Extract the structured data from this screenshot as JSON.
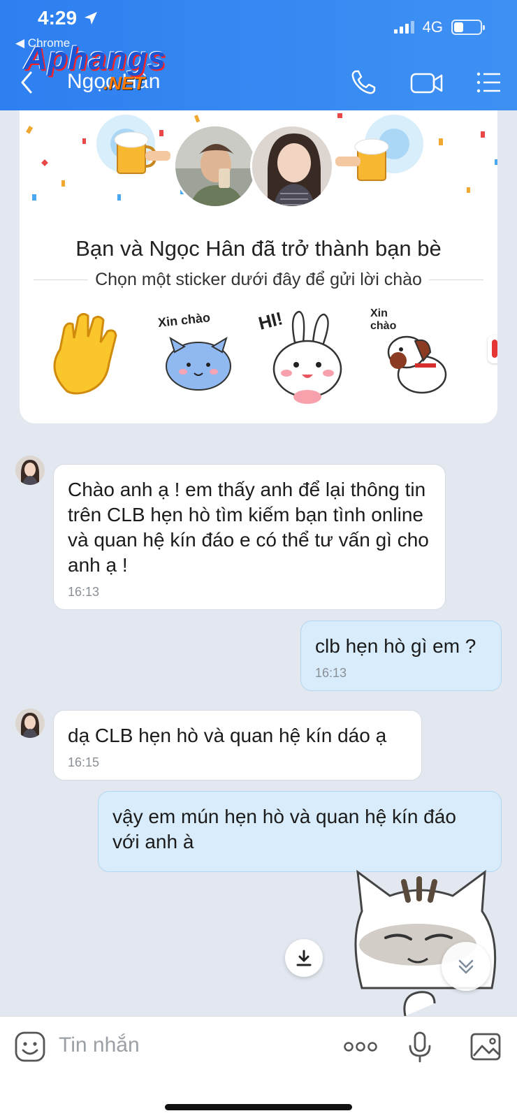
{
  "status_bar": {
    "time": "4:29",
    "back_app": "◀ Chrome",
    "network": "4G",
    "battery_level": 0.35
  },
  "header": {
    "chat_name": "Ngọc Hân",
    "watermark": "Aphangs",
    "watermark_suffix": ".NET"
  },
  "friend_card": {
    "title": "Bạn và Ngọc Hân đã trở thành bạn bè",
    "subtitle": "Chọn một sticker dưới đây để gửi lời chào",
    "stickers": [
      {
        "name": "wave-hand-sticker"
      },
      {
        "name": "blue-cat-sticker",
        "caption": "Xin chào"
      },
      {
        "name": "bunny-hi-sticker",
        "caption": "HI!"
      },
      {
        "name": "dog-sticker",
        "caption": "Xin chào"
      }
    ]
  },
  "messages": [
    {
      "direction": "in",
      "text": "Chào anh ạ ! em thấy anh để lại thông tin trên CLB hẹn hò tìm kiếm bạn tình online và quan hệ kín đáo e có thể tư vấn gì cho anh   ạ !",
      "time": "16:13"
    },
    {
      "direction": "out",
      "text": "clb hẹn hò gì em ?",
      "time": "16:13"
    },
    {
      "direction": "in",
      "text": "dạ CLB hẹn hò và quan hệ kín dáo ạ",
      "time": "16:15"
    },
    {
      "direction": "out",
      "text": "vậy em mún hẹn hò và quan hệ kín đáo với anh à",
      "time": ""
    }
  ],
  "composer": {
    "placeholder": "Tin nhắn"
  }
}
